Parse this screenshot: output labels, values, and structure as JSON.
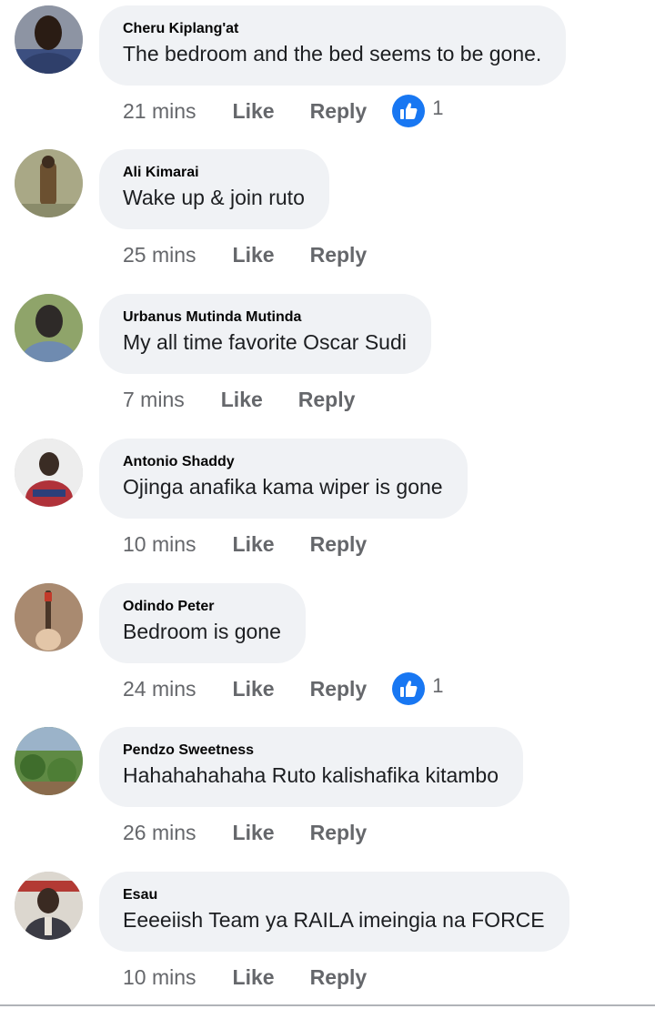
{
  "comments": [
    {
      "author": "Cheru Kiplang'at",
      "text": "The bedroom and the bed seems to be gone.",
      "time": "21 mins",
      "like_label": "Like",
      "reply_label": "Reply",
      "reaction_count": "1",
      "avatar_colors": [
        "#4a5e87",
        "#2a1c14"
      ]
    },
    {
      "author": "Ali Kimarai",
      "text": "Wake up & join ruto",
      "time": "25 mins",
      "like_label": "Like",
      "reply_label": "Reply",
      "reaction_count": null,
      "avatar_colors": [
        "#9b9a76",
        "#6b5030"
      ]
    },
    {
      "author": "Urbanus Mutinda Mutinda",
      "text": "My all time favorite Oscar Sudi",
      "time": "7 mins",
      "like_label": "Like",
      "reply_label": "Reply",
      "reaction_count": null,
      "avatar_colors": [
        "#8fa46a",
        "#2e2a28"
      ]
    },
    {
      "author": "Antonio Shaddy",
      "text": "Ojinga anafika kama wiper is gone",
      "time": "10 mins",
      "like_label": "Like",
      "reply_label": "Reply",
      "reaction_count": null,
      "avatar_colors": [
        "#e8e8e8",
        "#b0323a"
      ]
    },
    {
      "author": "Odindo Peter",
      "text": "Bedroom is gone",
      "time": "24 mins",
      "like_label": "Like",
      "reply_label": "Reply",
      "reaction_count": "1",
      "avatar_colors": [
        "#a17c5e",
        "#6a4d38"
      ]
    },
    {
      "author": "Pendzo Sweetness",
      "text": "Hahahahahaha Ruto kalishafika kitambo",
      "time": "26 mins",
      "like_label": "Like",
      "reply_label": "Reply",
      "reaction_count": null,
      "avatar_colors": [
        "#4f7e3a",
        "#8a6b4c"
      ]
    },
    {
      "author": "Esau",
      "text": "Eeeeiish Team ya RAILA imeingia na FORCE",
      "time": "10 mins",
      "like_label": "Like",
      "reply_label": "Reply",
      "reaction_count": null,
      "avatar_colors": [
        "#d9d4cc",
        "#3a2a22"
      ]
    }
  ],
  "colors": {
    "bubble_background": "#f0f2f5",
    "meta_text": "#65676b",
    "like_badge": "#1877f2"
  }
}
